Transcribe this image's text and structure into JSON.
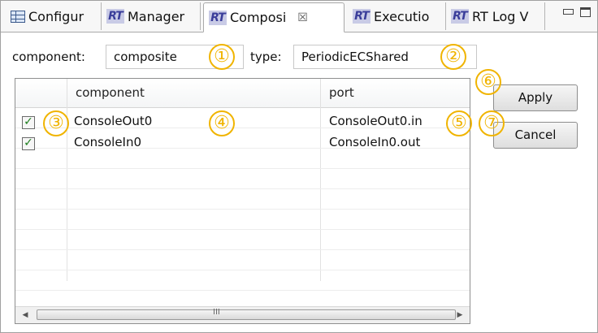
{
  "tabs": [
    {
      "label": "Configur",
      "icon": "table-icon"
    },
    {
      "label": "Manager",
      "icon": "rt-icon"
    },
    {
      "label": "Composi",
      "icon": "rt-icon",
      "active": true,
      "close": "☒"
    },
    {
      "label": "Executio",
      "icon": "rt-icon"
    },
    {
      "label": "RT Log V",
      "icon": "rt-icon"
    }
  ],
  "rt_icon_text": "RT",
  "form": {
    "component_label": "component:",
    "component_value": "composite",
    "type_label": "type:",
    "type_value": "PeriodicECShared"
  },
  "table": {
    "columns": [
      "component",
      "port"
    ],
    "rows": [
      {
        "checked": true,
        "component": "ConsoleOut0",
        "port": "ConsoleOut0.in"
      },
      {
        "checked": true,
        "component": "ConsoleIn0",
        "port": "ConsoleIn0.out"
      }
    ],
    "scroll_left": "◀",
    "scroll_right": "▶",
    "scroll_grip": "III"
  },
  "buttons": {
    "apply": "Apply",
    "cancel": "Cancel"
  },
  "annotations": [
    "①",
    "②",
    "③",
    "④",
    "⑤",
    "⑥",
    "⑦"
  ],
  "colors": {
    "annotation": "#f0b400",
    "check": "#1d7e1d",
    "rt_icon_bg": "#c9cbe6",
    "rt_icon_fg": "#3a3d9a"
  }
}
